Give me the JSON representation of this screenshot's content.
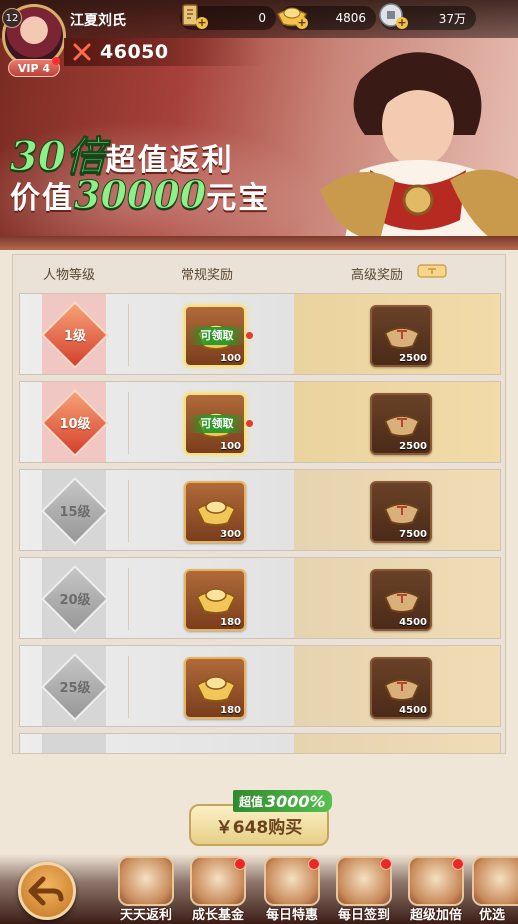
{
  "player": {
    "level": "12",
    "name": "江夏刘氏",
    "vip": "VIP 4",
    "power": "46050"
  },
  "resources": [
    {
      "icon": "fame-token-icon",
      "value": "0"
    },
    {
      "icon": "gold-ingot-icon",
      "value": "4806"
    },
    {
      "icon": "silver-coin-icon",
      "value": "37万"
    }
  ],
  "promo": {
    "line1_big": "30倍",
    "line1_text": "超值返利",
    "line2_text_a": "价值",
    "line2_big": "30000",
    "line2_text_b": "元宝"
  },
  "table": {
    "headers": {
      "level": "人物等级",
      "normal": "常规奖励",
      "premium": "高级奖励"
    },
    "claim_label": "可领取",
    "rows": [
      {
        "level": "1级",
        "normal_qty": "100",
        "premium_qty": "2500",
        "state": "unlocked",
        "claimable": true
      },
      {
        "level": "10级",
        "normal_qty": "100",
        "premium_qty": "2500",
        "state": "unlocked",
        "claimable": true
      },
      {
        "level": "15级",
        "normal_qty": "300",
        "premium_qty": "7500",
        "state": "locked",
        "claimable": false
      },
      {
        "level": "20级",
        "normal_qty": "180",
        "premium_qty": "4500",
        "state": "locked",
        "claimable": false
      },
      {
        "level": "25级",
        "normal_qty": "180",
        "premium_qty": "4500",
        "state": "locked",
        "claimable": false
      }
    ]
  },
  "buy": {
    "tag_prefix": "超值",
    "tag_value": "3000%",
    "button": "￥648购买"
  },
  "nav": [
    {
      "label": "天天返利",
      "dot": false
    },
    {
      "label": "成长基金",
      "dot": true
    },
    {
      "label": "每日特惠",
      "dot": true
    },
    {
      "label": "每日签到",
      "dot": true
    },
    {
      "label": "超级加倍",
      "dot": true
    },
    {
      "label": "优选",
      "dot": false
    }
  ],
  "colors": {
    "accent_green": "#8ff08a",
    "panel_bg": "#f0e6d7",
    "gold": "#e9b35a",
    "alert_red": "#e23a2c"
  }
}
